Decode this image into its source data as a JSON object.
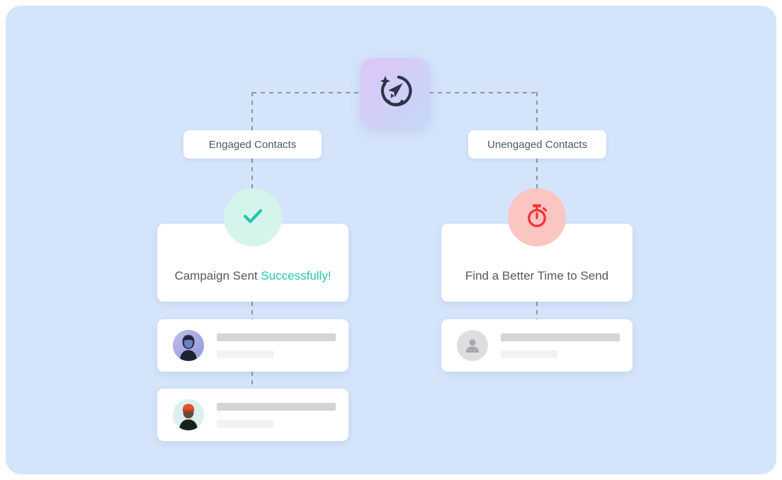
{
  "panel": {
    "background_color": "#d4e4fb",
    "page_background": "#ffffff"
  },
  "root_node": {
    "icon_name": "crystal-ball-paper-plane-icon",
    "gradient_from": "#ddc6f7",
    "gradient_to": "#c3d8f6",
    "icon_color": "#2b3548"
  },
  "connectors": {
    "color": "#8e949c",
    "style": "dashed"
  },
  "branches": [
    {
      "id": "engaged",
      "pill_label": "Engaged Contacts",
      "status_card": {
        "text_prefix": "Campaign Sent ",
        "text_accent": "Successfully!",
        "accent_color": "#21c6a8"
      },
      "badge": {
        "icon_name": "check-icon",
        "circle_color": "#d4f4ec",
        "icon_color": "#21c6a8"
      },
      "contacts": [
        {
          "avatar_name": "avatar-photo-woman",
          "avatar_kind": "photo"
        },
        {
          "avatar_name": "avatar-photo-man-beanie",
          "avatar_kind": "photo"
        }
      ]
    },
    {
      "id": "unengaged",
      "pill_label": "Unengaged Contacts",
      "status_card": {
        "text_prefix": "Find a Better Time to Send",
        "text_accent": "",
        "accent_color": "#f4353a"
      },
      "badge": {
        "icon_name": "stopwatch-icon",
        "circle_color": "#fbc5c1",
        "icon_color": "#f4353a"
      },
      "contacts": [
        {
          "avatar_name": "avatar-generic-person",
          "avatar_kind": "generic"
        }
      ]
    }
  ]
}
